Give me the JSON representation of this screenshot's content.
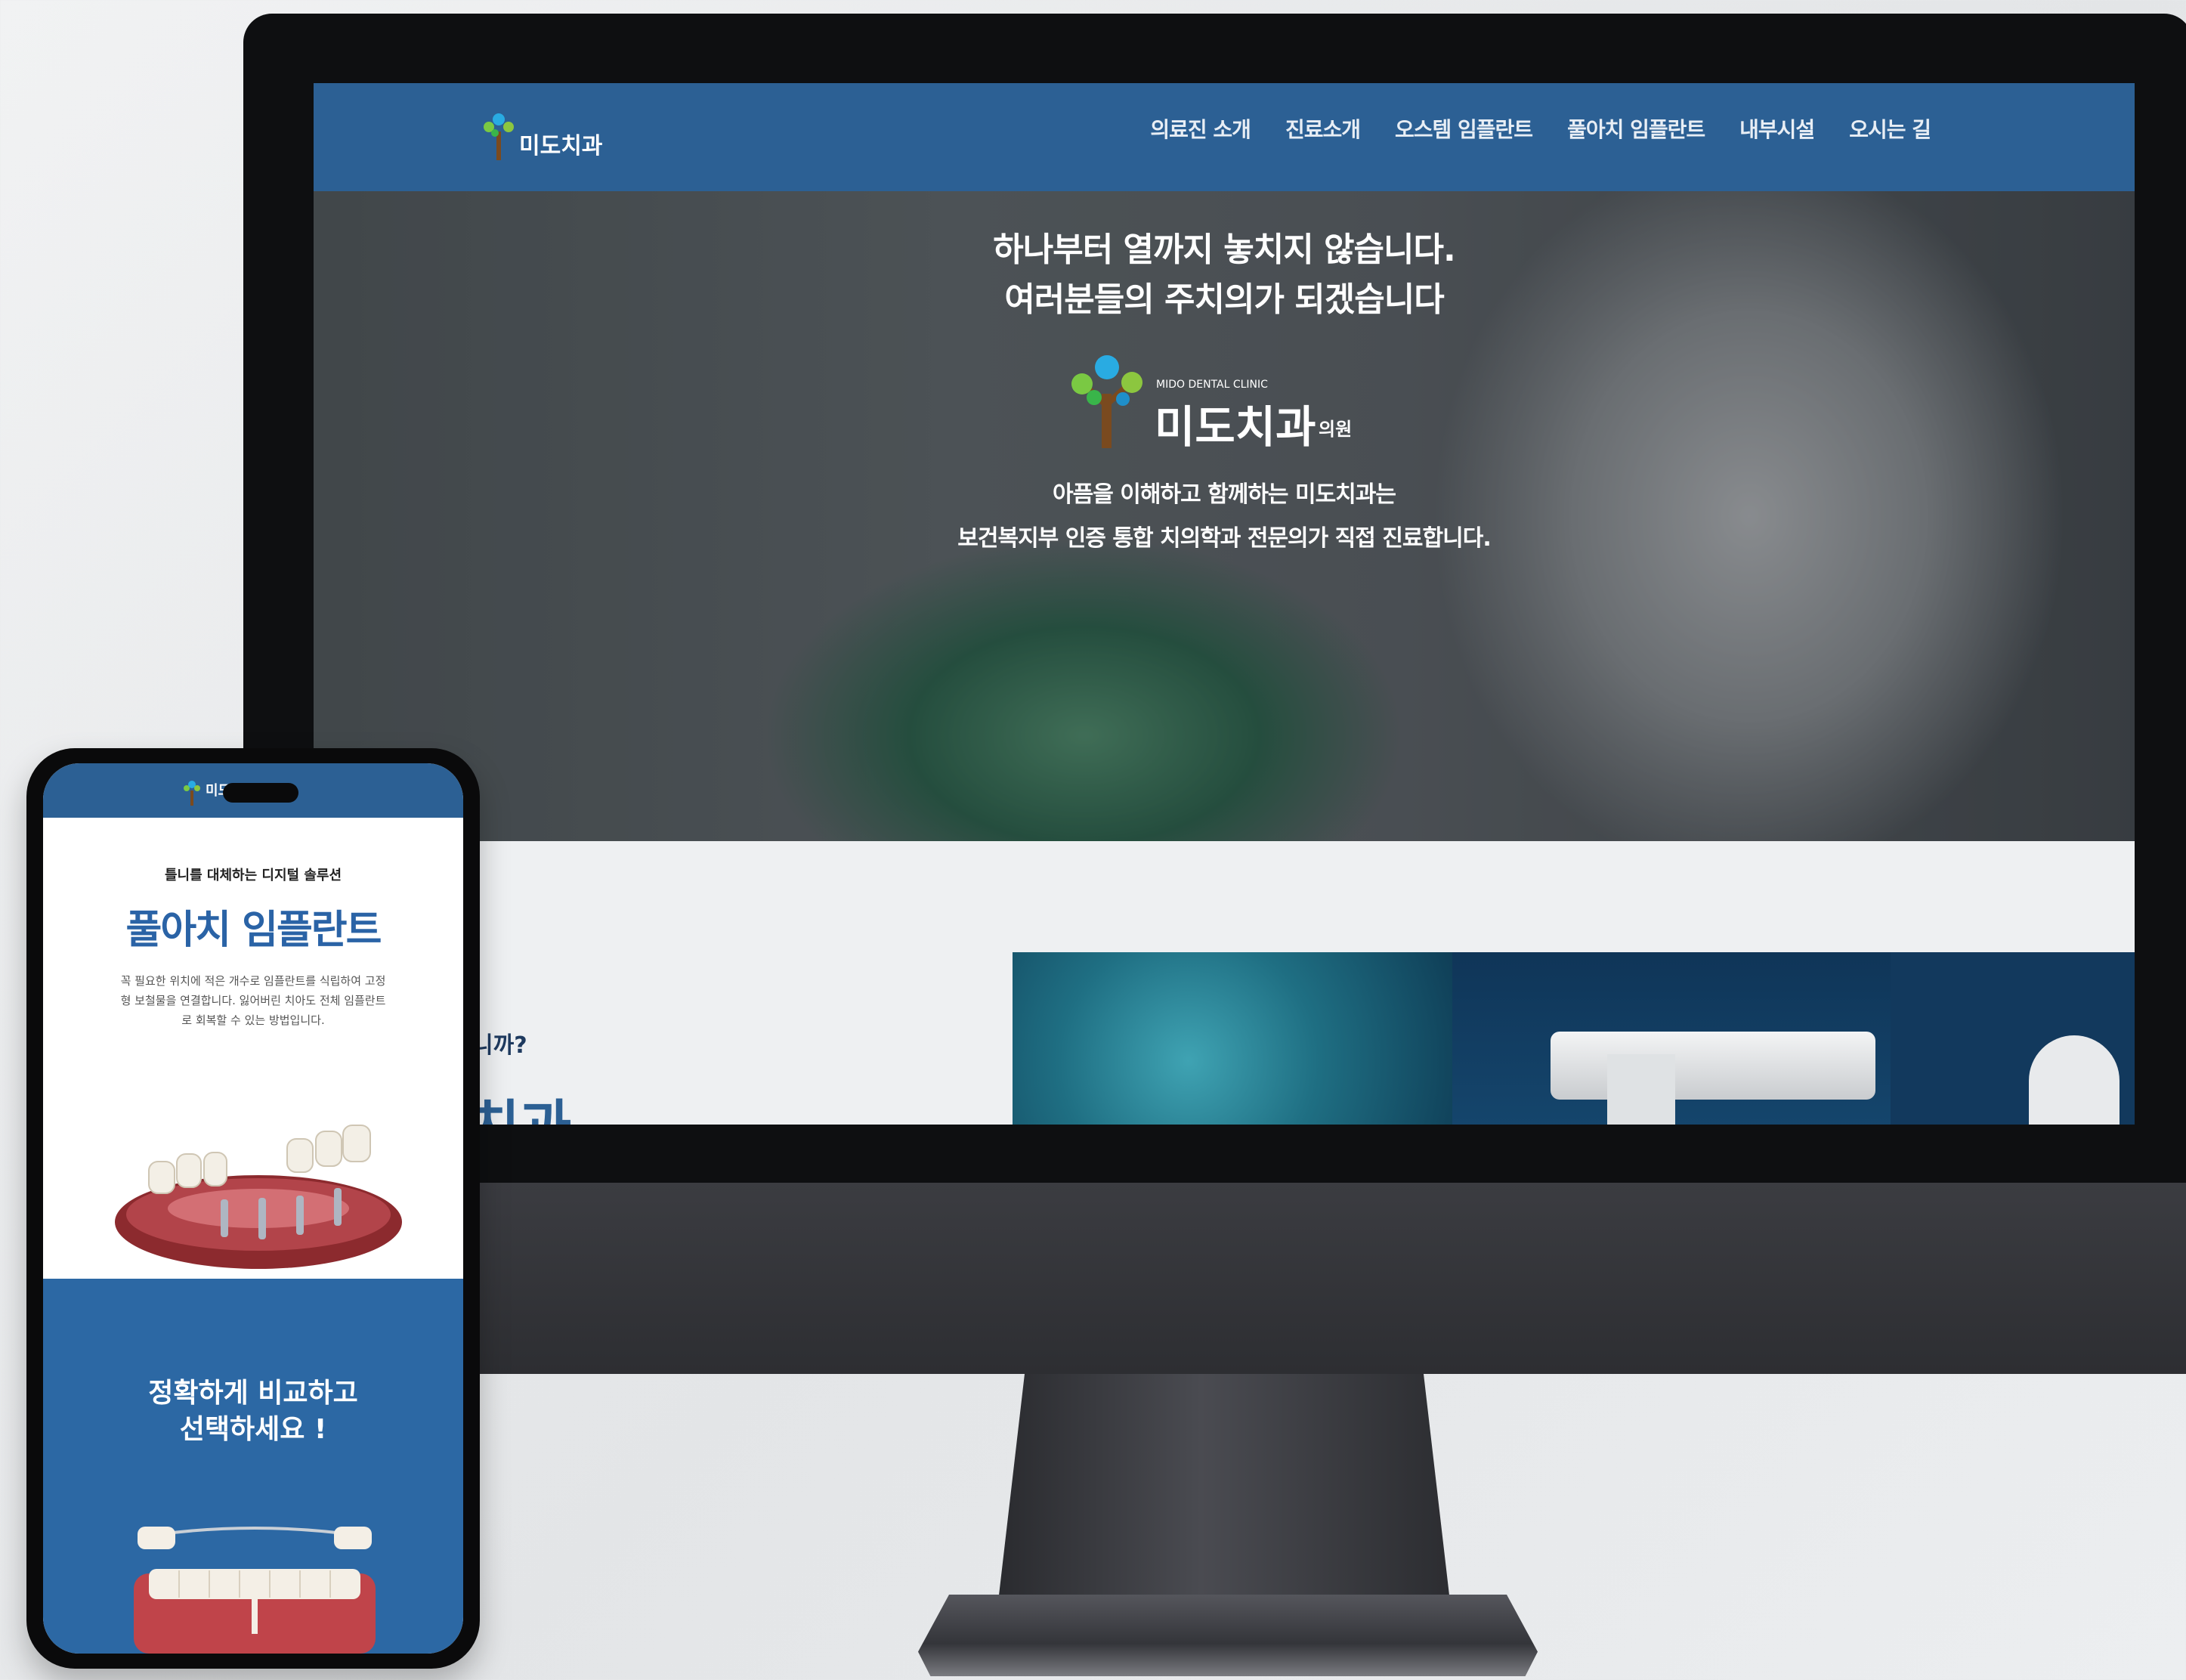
{
  "desktop": {
    "logo_text": "미도치과",
    "nav": [
      "의료진 소개",
      "진료소개",
      "오스템 임플란트",
      "풀아치 임플란트",
      "내부시설",
      "오시는 길"
    ],
    "hero": {
      "headline_line1": "하나부터 열까지 놓치지 않습니다.",
      "headline_line2": "여러분들의 주치의가 되겠습니다",
      "clinic_sub": "MIDO DENTAL CLINIC",
      "clinic_name": "미도치과",
      "clinic_suffix": "의원",
      "desc_line1": "아픔을 이해하고 함께하는 미도치과는",
      "desc_line2": "보건복지부 인증 통합 치의학과 전문의가 직접 진료합니다."
    },
    "section": {
      "question_partial": "니까?",
      "title_partial": "치과"
    }
  },
  "mobile": {
    "logo_text": "미도치과",
    "kicker": "틀니를 대체하는 디지털 솔루션",
    "title": "풀아치 임플란트",
    "desc": "꼭 필요한 위치에 적은 개수로 임플란트를 식립하여 고정형 보철물을 연결합니다. 잃어버린 치아도 전체 임플란트로 회복할 수 있는 방법입니다.",
    "compare_line1": "정확하게 비교하고",
    "compare_line2": "선택하세요 !"
  },
  "colors": {
    "brand_blue": "#2c6094",
    "mobile_blue": "#2c68a4",
    "title_blue": "#2a63a6"
  }
}
